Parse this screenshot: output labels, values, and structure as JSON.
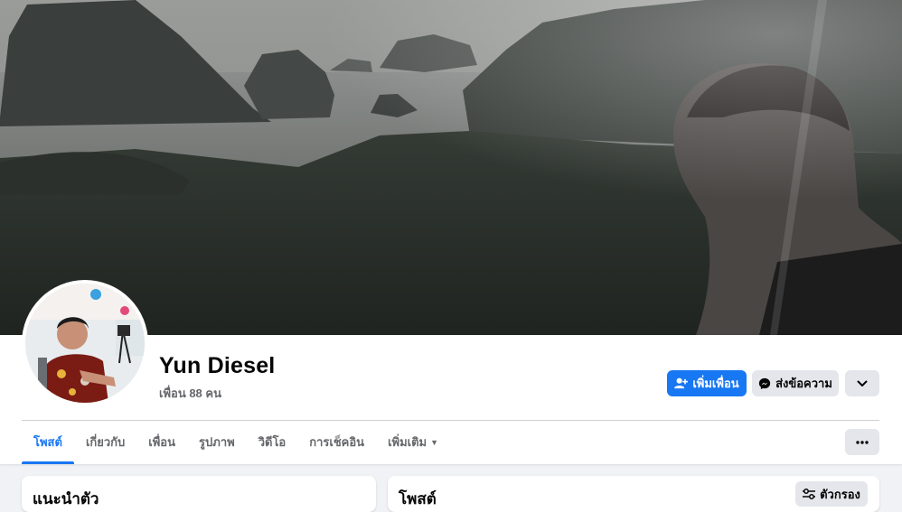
{
  "profile": {
    "name": "Yun Diesel",
    "friends_count": "เพื่อน 88 คน"
  },
  "actions": {
    "add_friend": "เพิ่มเพื่อน",
    "message": "ส่งข้อความ"
  },
  "tabs": [
    {
      "label": "โพสต์",
      "active": true
    },
    {
      "label": "เกี่ยวกับ",
      "active": false
    },
    {
      "label": "เพื่อน",
      "active": false
    },
    {
      "label": "รูปภาพ",
      "active": false
    },
    {
      "label": "วิดีโอ",
      "active": false
    },
    {
      "label": "การเช็คอิน",
      "active": false
    },
    {
      "label": "เพิ่มเติม",
      "active": false
    }
  ],
  "intro_card": {
    "title": "แนะนำตัว"
  },
  "posts_card": {
    "title": "โพสต์",
    "filter_label": "ตัวกรอง"
  },
  "icons": {
    "add_friend": "person-add-icon",
    "messenger": "messenger-icon",
    "dropdown": "chevron-down-icon",
    "more": "more-icon",
    "filter": "sliders-icon",
    "tab_more_caret": "caret-down-icon"
  },
  "colors": {
    "primary": "#1877f2",
    "secondary_bg": "#e4e6eb",
    "page_bg": "#f0f2f5",
    "muted_text": "#65676b"
  }
}
